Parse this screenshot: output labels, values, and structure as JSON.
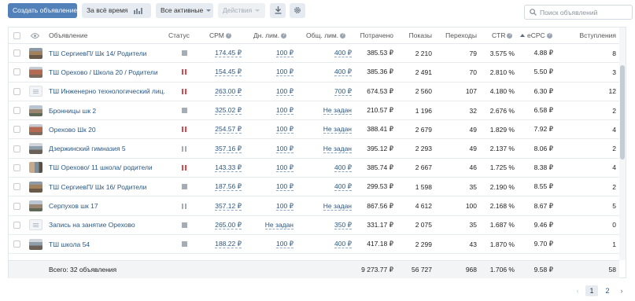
{
  "toolbar": {
    "create_label": "Создать объявление",
    "period_label": "За всё время",
    "filter_label": "Все активные",
    "actions_label": "Действия",
    "search_placeholder": "Поиск объявлений"
  },
  "columns": {
    "ad": "Объявление",
    "status": "Статус",
    "cpm": "CPM",
    "day_limit": "Дн. лим.",
    "total_limit": "Общ. лим.",
    "spent": "Потрачено",
    "impressions": "Показы",
    "clicks": "Переходы",
    "ctr": "CTR",
    "ecpc": "eCPC",
    "joins": "Вступления",
    "help_glyph": "?"
  },
  "rows": [
    {
      "name": "ТШ СергиевП/ Шк 14/ Родители",
      "thumb": "photo-a",
      "status": "stopped",
      "cpm": "174.45 ₽",
      "day_limit": "100 ₽",
      "total_limit": "400 ₽",
      "spent": "385.53 ₽",
      "impressions": "2 210",
      "clicks": "79",
      "ctr": "3.575 %",
      "ecpc": "4.88 ₽",
      "joins": "8"
    },
    {
      "name": "ТШ Орехово / Школа 20 / Родители",
      "thumb": "photo-b",
      "status": "paused",
      "cpm": "154.45 ₽",
      "day_limit": "100 ₽",
      "total_limit": "400 ₽",
      "spent": "385.36 ₽",
      "impressions": "2 491",
      "clicks": "70",
      "ctr": "2.810 %",
      "ecpc": "5.50 ₽",
      "joins": "3"
    },
    {
      "name": "ТШ Инженерно технологический лиц...",
      "thumb": "doc",
      "status": "paused",
      "cpm": "263.00 ₽",
      "day_limit": "100 ₽",
      "total_limit": "700 ₽",
      "spent": "674.53 ₽",
      "impressions": "2 560",
      "clicks": "107",
      "ctr": "4.180 %",
      "ecpc": "6.30 ₽",
      "joins": "12"
    },
    {
      "name": "Бронницы шк 2",
      "thumb": "photo-c",
      "status": "stopped",
      "cpm": "325.02 ₽",
      "day_limit": "100 ₽",
      "total_limit": "Не задан",
      "spent": "210.57 ₽",
      "impressions": "1 196",
      "clicks": "32",
      "ctr": "2.676 %",
      "ecpc": "6.58 ₽",
      "joins": "2"
    },
    {
      "name": "Орехово Шк 20",
      "thumb": "photo-b",
      "status": "paused",
      "cpm": "254.57 ₽",
      "day_limit": "100 ₽",
      "total_limit": "Не задан",
      "spent": "388.41 ₽",
      "impressions": "2 679",
      "clicks": "49",
      "ctr": "1.829 %",
      "ecpc": "7.92 ₽",
      "joins": "4"
    },
    {
      "name": "Дзержинский гимназия 5",
      "thumb": "photo-d",
      "status": "paused-grey",
      "cpm": "357.16 ₽",
      "day_limit": "100 ₽",
      "total_limit": "Не задан",
      "spent": "395.12 ₽",
      "impressions": "2 293",
      "clicks": "49",
      "ctr": "2.137 %",
      "ecpc": "8.06 ₽",
      "joins": "2"
    },
    {
      "name": "ТШ Орехово/ 11 школа/ родители",
      "thumb": "photo-e",
      "status": "paused",
      "cpm": "143.33 ₽",
      "day_limit": "100 ₽",
      "total_limit": "400 ₽",
      "spent": "385.74 ₽",
      "impressions": "2 667",
      "clicks": "46",
      "ctr": "1.725 %",
      "ecpc": "8.38 ₽",
      "joins": "4"
    },
    {
      "name": "ТШ СергиевП/ Шк 16/ Родители",
      "thumb": "photo-a",
      "status": "stopped",
      "cpm": "187.56 ₽",
      "day_limit": "100 ₽",
      "total_limit": "400 ₽",
      "spent": "299.53 ₽",
      "impressions": "1 598",
      "clicks": "35",
      "ctr": "2.190 %",
      "ecpc": "8.55 ₽",
      "joins": "2"
    },
    {
      "name": "Серпухов шк 17",
      "thumb": "photo-c",
      "status": "paused-grey",
      "cpm": "357.12 ₽",
      "day_limit": "100 ₽",
      "total_limit": "Не задан",
      "spent": "867.56 ₽",
      "impressions": "4 612",
      "clicks": "100",
      "ctr": "2.168 %",
      "ecpc": "8.67 ₽",
      "joins": "5"
    },
    {
      "name": "Запись на занятие Орехово",
      "thumb": "doc",
      "status": "stopped",
      "cpm": "265.00 ₽",
      "day_limit": "Не задан",
      "total_limit": "350 ₽",
      "spent": "331.17 ₽",
      "impressions": "2 075",
      "clicks": "35",
      "ctr": "1.687 %",
      "ecpc": "9.46 ₽",
      "joins": "0"
    },
    {
      "name": "ТШ школа 54",
      "thumb": "photo-d",
      "status": "stopped",
      "cpm": "188.22 ₽",
      "day_limit": "100 ₽",
      "total_limit": "400 ₽",
      "spent": "417.18 ₽",
      "impressions": "2 299",
      "clicks": "43",
      "ctr": "1.870 %",
      "ecpc": "9.70 ₽",
      "joins": "1"
    }
  ],
  "totals": {
    "label": "Всего: 32 объявления",
    "spent": "9 273.77 ₽",
    "impressions": "56 727",
    "clicks": "968",
    "ctr": "1.706 %",
    "ecpc": "9.58 ₽",
    "joins": "58"
  },
  "pagination": {
    "prev": "‹",
    "pages": [
      "1",
      "2"
    ],
    "current": "1",
    "next": "›"
  },
  "icons": {
    "period": "columns-chart-icon",
    "download": "download-icon",
    "settings": "gear-icon",
    "search": "search-icon",
    "visibility": "eye-icon"
  },
  "colors": {
    "accent": "#5181b8",
    "link": "#2a5885",
    "paused": "#e0484c",
    "stopped": "#a4acb5"
  }
}
